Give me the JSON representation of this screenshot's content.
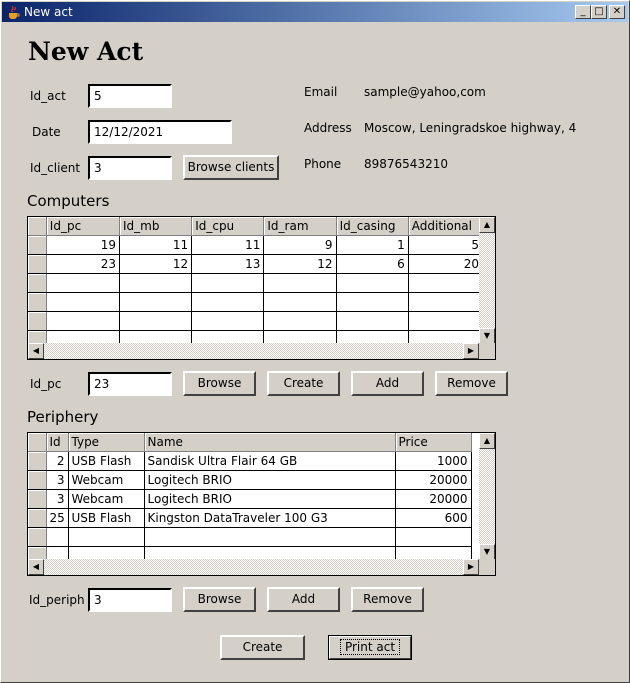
{
  "window": {
    "title": "New act"
  },
  "heading": "New Act",
  "form": {
    "id_act_label": "Id_act",
    "id_act_value": "5",
    "date_label": "Date",
    "date_value": "12/12/2021",
    "id_client_label": "Id_client",
    "id_client_value": "3",
    "browse_clients_label": "Browse clients",
    "email_label": "Email",
    "email_value": "sample@yahoo,com",
    "address_label": "Address",
    "address_value": "Moscow, Leningradskoe highway, 4",
    "phone_label": "Phone",
    "phone_value": "89876543210"
  },
  "computers": {
    "title": "Computers",
    "columns": [
      "Id_pc",
      "Id_mb",
      "Id_cpu",
      "Id_ram",
      "Id_casing",
      "Additional"
    ],
    "rows": [
      [
        "19",
        "11",
        "11",
        "9",
        "1",
        "5"
      ],
      [
        "23",
        "12",
        "13",
        "12",
        "6",
        "20"
      ]
    ],
    "id_pc_label": "Id_pc",
    "id_pc_value": "23",
    "browse_label": "Browse",
    "create_label": "Create",
    "add_label": "Add",
    "remove_label": "Remove"
  },
  "periphery": {
    "title": "Periphery",
    "columns": [
      "Id",
      "Type",
      "Name",
      "Price"
    ],
    "rows": [
      [
        "2",
        "USB Flash",
        "Sandisk Ultra Flair 64 GB",
        "1000"
      ],
      [
        "3",
        "Webcam",
        "Logitech BRIO",
        "20000"
      ],
      [
        "3",
        "Webcam",
        "Logitech BRIO",
        "20000"
      ],
      [
        "25",
        "USB Flash",
        "Kingston DataTraveler 100 G3",
        "600"
      ]
    ],
    "id_periph_label": "Id_periph",
    "id_periph_value": "3",
    "browse_label": "Browse",
    "add_label": "Add",
    "remove_label": "Remove"
  },
  "footer": {
    "create_label": "Create",
    "print_label": "Print act"
  },
  "icons": {
    "app": "java-cup-icon",
    "minimize": "minimize-icon",
    "maximize": "maximize-icon",
    "close": "close-icon"
  },
  "colors": {
    "titlebar_start": "#0a246a",
    "titlebar_end": "#a6caf0",
    "face": "#d4d0c8"
  }
}
